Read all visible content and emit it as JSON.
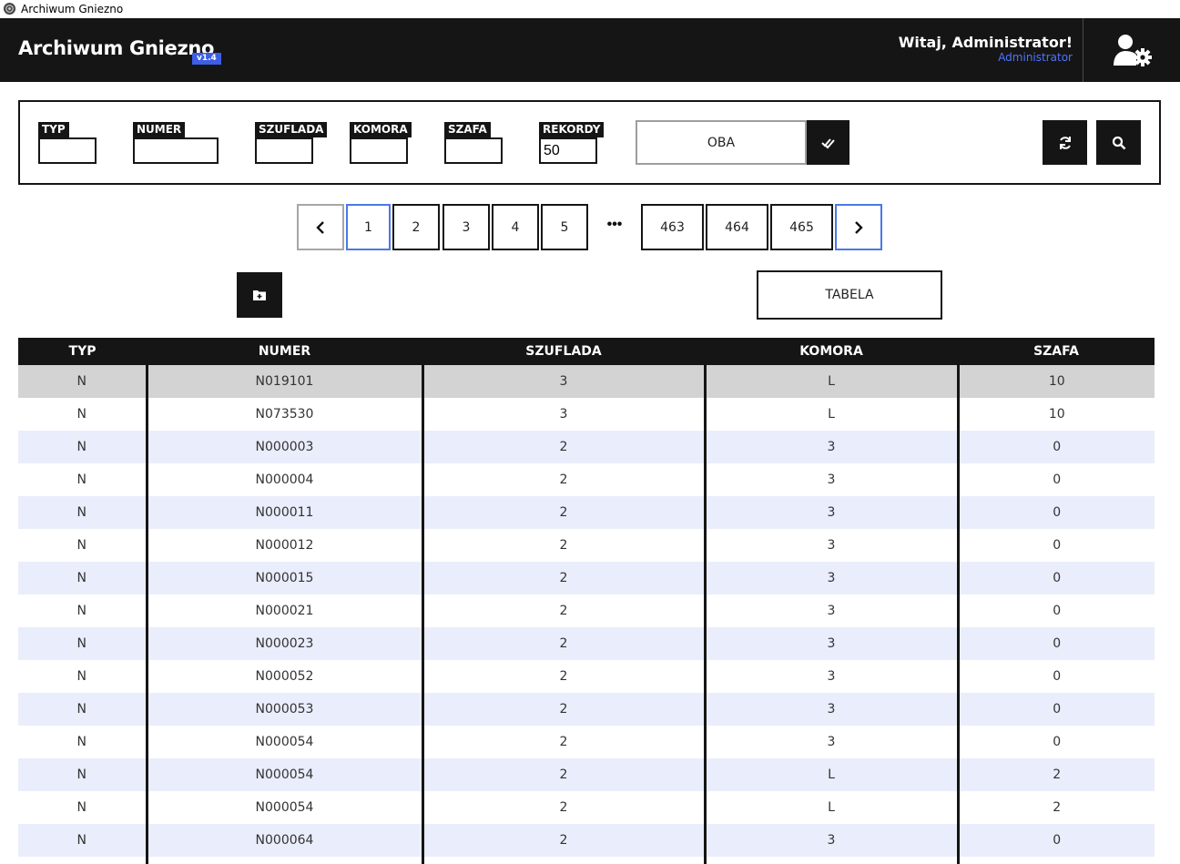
{
  "window": {
    "title": "Archiwum Gniezno"
  },
  "header": {
    "brand": "Archiwum Gniezno",
    "version": "v1.4",
    "greeting": "Witaj, Administrator!",
    "role": "Administrator"
  },
  "filters": {
    "fields": [
      {
        "label": "TYP",
        "value": ""
      },
      {
        "label": "NUMER",
        "value": ""
      },
      {
        "label": "SZUFLADA",
        "value": ""
      },
      {
        "label": "KOMORA",
        "value": ""
      },
      {
        "label": "SZAFA",
        "value": ""
      },
      {
        "label": "REKORDY",
        "value": "50"
      }
    ],
    "mode": "OBA"
  },
  "pagination": {
    "prev_icon": "chevron-left-icon",
    "next_icon": "chevron-right-icon",
    "pages": [
      "1",
      "2",
      "3",
      "4",
      "5",
      "463",
      "464",
      "465"
    ],
    "ellipsis": "•••",
    "current": "1"
  },
  "actions": {
    "view_toggle": "TABELA"
  },
  "table": {
    "columns": [
      "TYP",
      "NUMER",
      "SZUFLADA",
      "KOMORA",
      "SZAFA"
    ],
    "rows": [
      [
        "N",
        "N019101",
        "3",
        "L",
        "10"
      ],
      [
        "N",
        "N073530",
        "3",
        "L",
        "10"
      ],
      [
        "N",
        "N000003",
        "2",
        "3",
        "0"
      ],
      [
        "N",
        "N000004",
        "2",
        "3",
        "0"
      ],
      [
        "N",
        "N000011",
        "2",
        "3",
        "0"
      ],
      [
        "N",
        "N000012",
        "2",
        "3",
        "0"
      ],
      [
        "N",
        "N000015",
        "2",
        "3",
        "0"
      ],
      [
        "N",
        "N000021",
        "2",
        "3",
        "0"
      ],
      [
        "N",
        "N000023",
        "2",
        "3",
        "0"
      ],
      [
        "N",
        "N000052",
        "2",
        "3",
        "0"
      ],
      [
        "N",
        "N000053",
        "2",
        "3",
        "0"
      ],
      [
        "N",
        "N000054",
        "2",
        "3",
        "0"
      ],
      [
        "N",
        "N000054",
        "2",
        "L",
        "2"
      ],
      [
        "N",
        "N000054",
        "2",
        "L",
        "2"
      ],
      [
        "N",
        "N000064",
        "2",
        "3",
        "0"
      ],
      [
        "",
        "",
        "",
        "",
        ""
      ]
    ]
  },
  "colors": {
    "dark": "#151515",
    "accent": "#3d5ee6",
    "link": "#4f74ff",
    "row_alt": "#eaedfb",
    "row_selected": "#d3d3d3"
  }
}
